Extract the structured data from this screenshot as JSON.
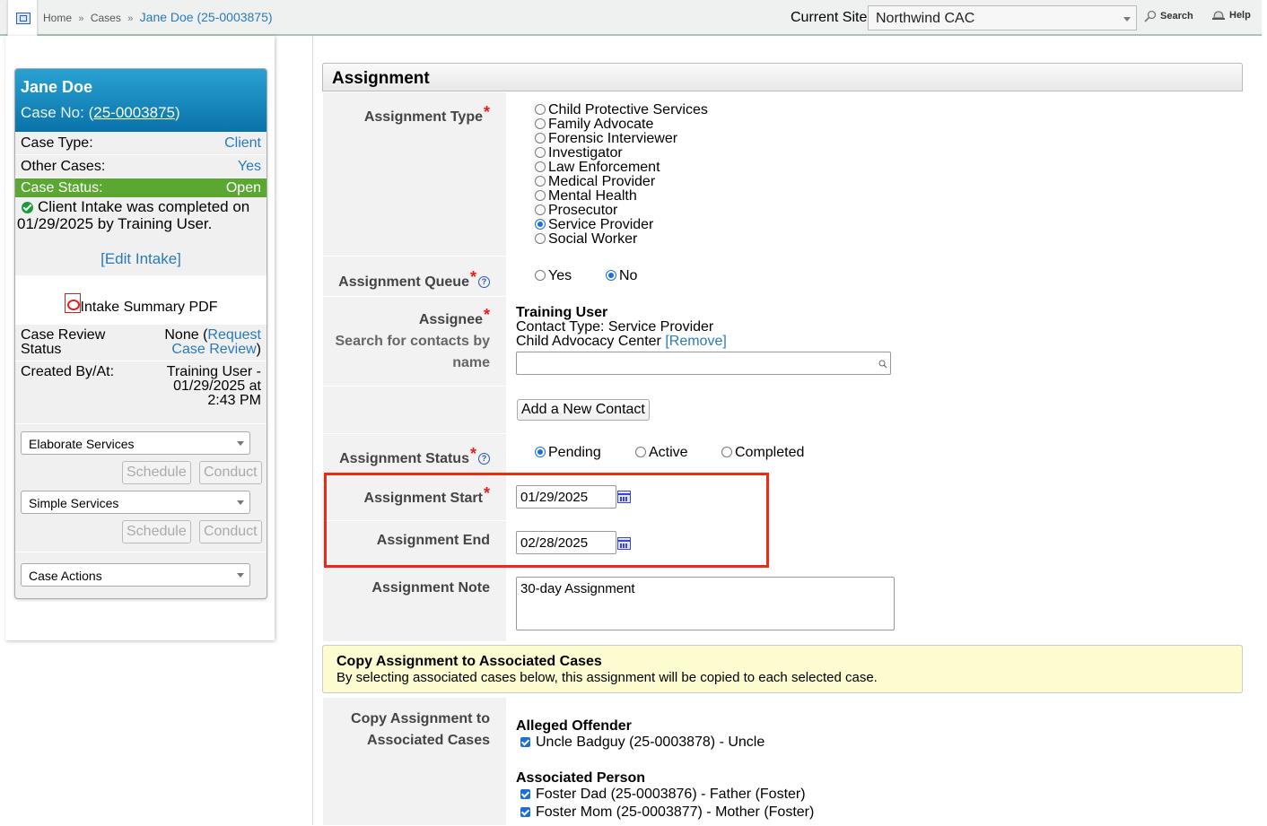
{
  "topbar": {
    "breadcrumbs": [
      "Home",
      "Cases"
    ],
    "breadcrumb_sep": "»",
    "breadcrumb_current": "Jane Doe (25-0003875)",
    "current_site_label": "Current Site",
    "current_site_value": "Northwind CAC",
    "search_label": "Search",
    "help_label": "Help"
  },
  "case_card": {
    "name": "Jane Doe",
    "case_no_prefix": "Case No: (",
    "case_no": "25-0003875",
    "case_no_suffix": ")",
    "case_type_label": "Case Type:",
    "case_type_value": "Client",
    "other_cases_label": "Other Cases:",
    "other_cases_value": "Yes",
    "case_status_label": "Case Status:",
    "case_status_value": "Open",
    "intake_message": "Client Intake was completed on 01/29/2025 by Training User.",
    "edit_intake": "[Edit Intake]",
    "intake_pdf": "Intake Summary PDF",
    "case_review_label": "Case Review Status",
    "case_review_none": "None (",
    "case_review_link": "Request Case Review",
    "case_review_close": ")",
    "created_label": "Created By/At:",
    "created_value": "Training User - 01/29/2025 at 2:43 PM",
    "elaborate_services": "Elaborate Services",
    "simple_services": "Simple Services",
    "schedule_label": "Schedule",
    "conduct_label": "Conduct",
    "case_actions": "Case Actions"
  },
  "form": {
    "section_title": "Assignment",
    "assignment_type_label": "Assignment Type",
    "assignment_types": [
      "Child Protective Services",
      "Family Advocate",
      "Forensic Interviewer",
      "Investigator",
      "Law Enforcement",
      "Medical Provider",
      "Mental Health",
      "Prosecutor",
      "Service Provider",
      "Social Worker"
    ],
    "assignment_type_selected": "Service Provider",
    "queue_label": "Assignment Queue",
    "queue_yes": "Yes",
    "queue_no": "No",
    "queue_selected": "No",
    "assignee_label": "Assignee",
    "assignee_sub_label": "Search for contacts by name",
    "assignee_name": "Training User",
    "assignee_contact_type": "Contact Type: Service Provider",
    "assignee_org": "Child Advocacy Center",
    "assignee_remove": "[Remove]",
    "assignee_search_value": "",
    "add_contact_button": "Add a New Contact",
    "status_label": "Assignment Status",
    "status_options": [
      "Pending",
      "Active",
      "Completed"
    ],
    "status_selected": "Pending",
    "start_label": "Assignment Start",
    "start_value": "01/29/2025",
    "end_label": "Assignment End",
    "end_value": "02/28/2025",
    "note_label": "Assignment Note",
    "note_value": "30-day Assignment",
    "copy_notice_title": "Copy Assignment to Associated Cases",
    "copy_notice_text": "By selecting associated cases below, this assignment will be copied to each selected case.",
    "copy_label": "Copy Assignment to Associated Cases",
    "alleged_offender_heading": "Alleged Offender",
    "alleged_offenders": [
      "Uncle Badguy (25-0003878) - Uncle"
    ],
    "associated_person_heading": "Associated Person",
    "associated_persons": [
      "Foster Dad (25-0003876) - Father (Foster)",
      "Foster Mom (25-0003877) - Mother (Foster)"
    ]
  },
  "colors": {
    "accent_link": "#2a7ab8",
    "card_header": "#0a73a9",
    "status_green": "#5aa832",
    "required": "#e02020",
    "highlight": "#ee2a14",
    "notice_bg": "#fdfbd0"
  }
}
